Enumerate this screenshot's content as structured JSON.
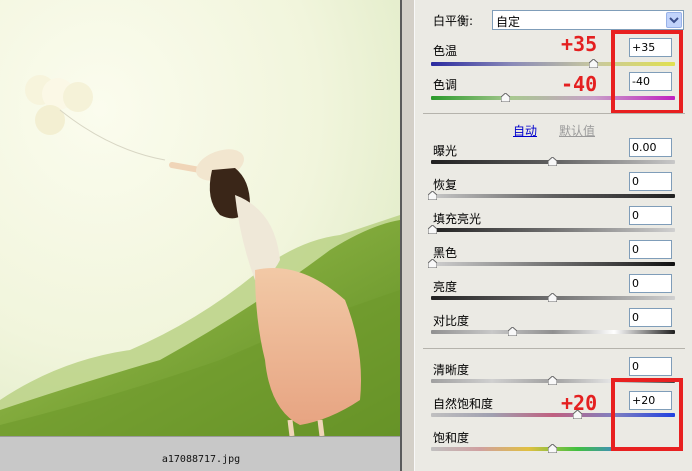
{
  "photo": {
    "filename": "a17088717.jpg"
  },
  "panel": {
    "white_balance": {
      "label": "白平衡:",
      "value": "自定"
    },
    "sliders_top": [
      {
        "label": "色温",
        "value": "+35",
        "position": 0.62
      },
      {
        "label": "色调",
        "value": "-40",
        "position": 0.3
      }
    ],
    "auto_link": "自动",
    "default_link": "默认值",
    "sliders_mid": [
      {
        "label": "曝光",
        "value": "0.00",
        "position": 0.5
      },
      {
        "label": "恢复",
        "value": "0",
        "position": 0.0
      },
      {
        "label": "填充亮光",
        "value": "0",
        "position": 0.0
      },
      {
        "label": "黑色",
        "value": "0",
        "position": 0.0
      },
      {
        "label": "亮度",
        "value": "0",
        "position": 0.5
      },
      {
        "label": "对比度",
        "value": "0",
        "position": 0.33
      }
    ],
    "sliders_bottom": [
      {
        "label": "清晰度",
        "value": "0",
        "position": 0.5
      },
      {
        "label": "自然饱和度",
        "value": "+20",
        "position": 0.6
      },
      {
        "label": "饱和度",
        "value": "0",
        "position": 0.5
      }
    ]
  },
  "annotations": {
    "temp": "+35",
    "tint": "-40",
    "vibrance": "+20",
    "color": "#e42020"
  }
}
